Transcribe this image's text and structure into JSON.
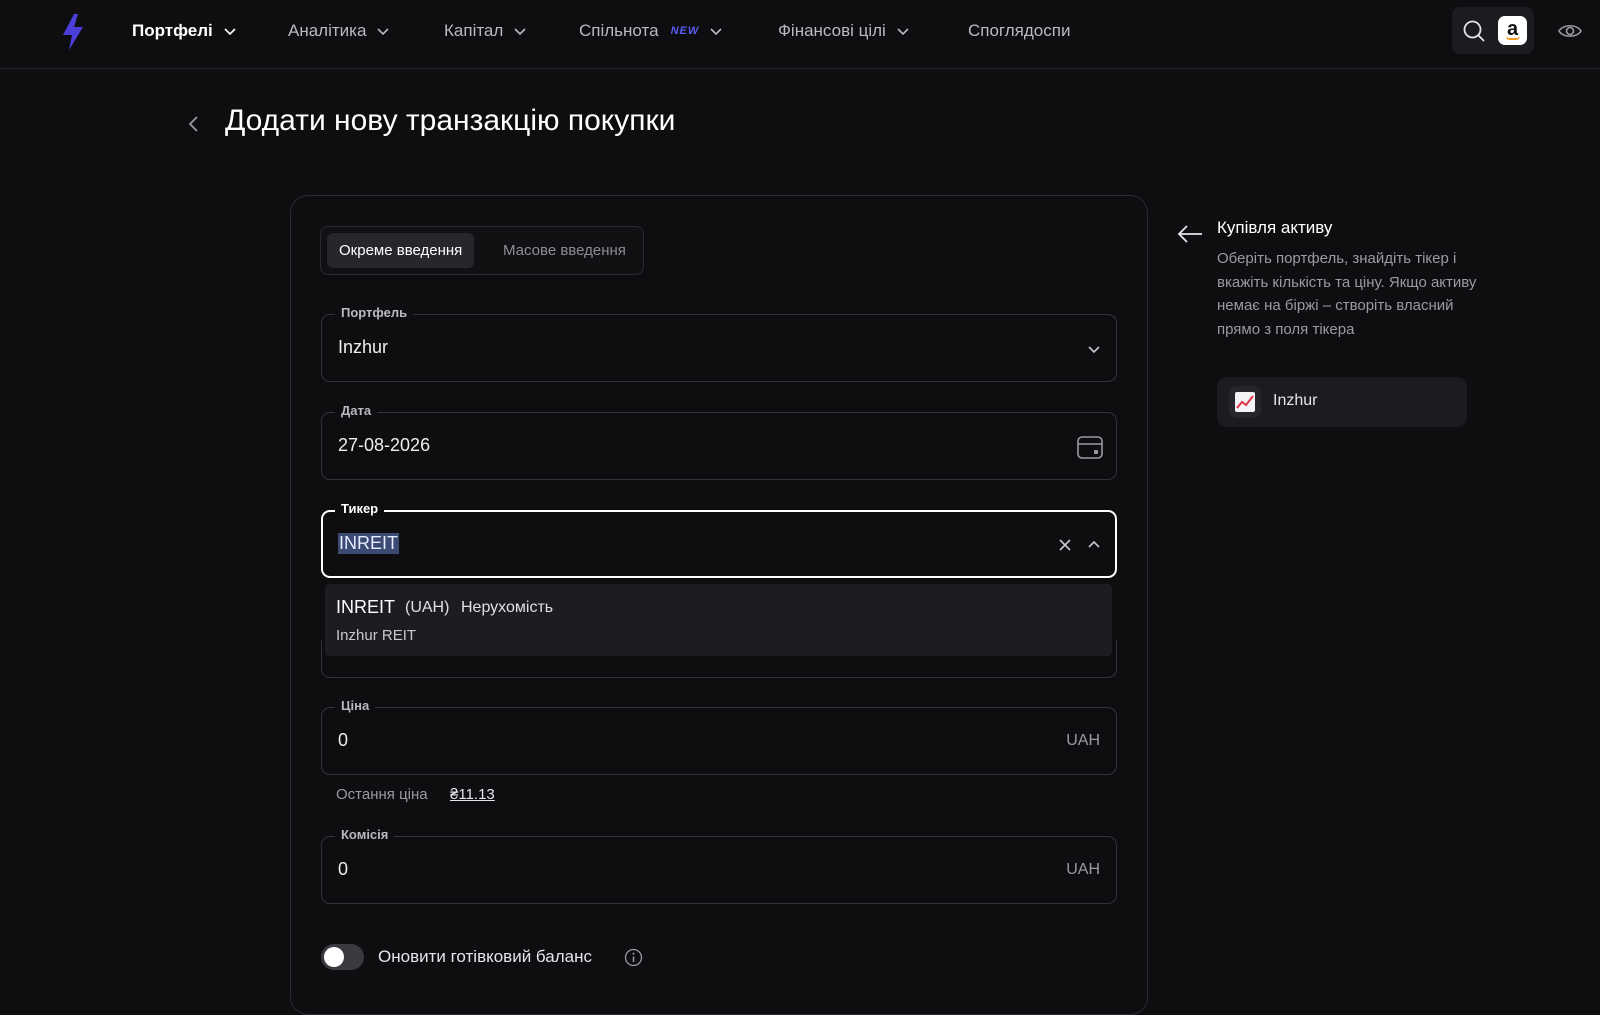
{
  "nav": {
    "items": [
      {
        "label": "Портфелі",
        "active": true
      },
      {
        "label": "Аналітика"
      },
      {
        "label": "Капітал"
      },
      {
        "label": "Спільнота",
        "badge": "NEW"
      },
      {
        "label": "Фінансові цілі"
      },
      {
        "label": "Споглядоспи"
      }
    ],
    "icons": {
      "logo": "lightning-logo-icon",
      "search": "search-icon",
      "amazon": "amazon-icon",
      "amazon_letter": "a",
      "eye": "eye-icon"
    },
    "accent": "#5b5cf0"
  },
  "page": {
    "title": "Додати нову транзакцію покупки"
  },
  "mode_tabs": {
    "single": "Окреме введення",
    "bulk": "Масове введення"
  },
  "form": {
    "portfolio": {
      "label": "Портфель",
      "value": "Inzhur"
    },
    "date": {
      "label": "Дата",
      "value": "27-08-2026"
    },
    "ticker": {
      "label": "Тикер",
      "value": "INREIT"
    },
    "price": {
      "label": "Ціна",
      "value": "0",
      "suffix": "UAH"
    },
    "commission": {
      "label": "Комісія",
      "value": "0",
      "suffix": "UAH"
    },
    "last_price_label": "Остання ціна",
    "last_price_value": "₴11.13",
    "update_cash_label": "Оновити готівковий баланс",
    "update_cash_on": false
  },
  "dropdown": {
    "options": [
      {
        "ticker": "INREIT",
        "currency": "(UAH)",
        "category": "Нерухомість",
        "name": "Inzhur REIT"
      }
    ]
  },
  "hint": {
    "title": "Купівля активу",
    "text": "Оберіть портфель, знайдіть тікер і вкажіть кількість та ціну. Якщо активу немає на біржі – створіть власний прямо з поля тікера",
    "portfolio_chip": "Inzhur",
    "chip_icon": "chart-up-icon"
  }
}
